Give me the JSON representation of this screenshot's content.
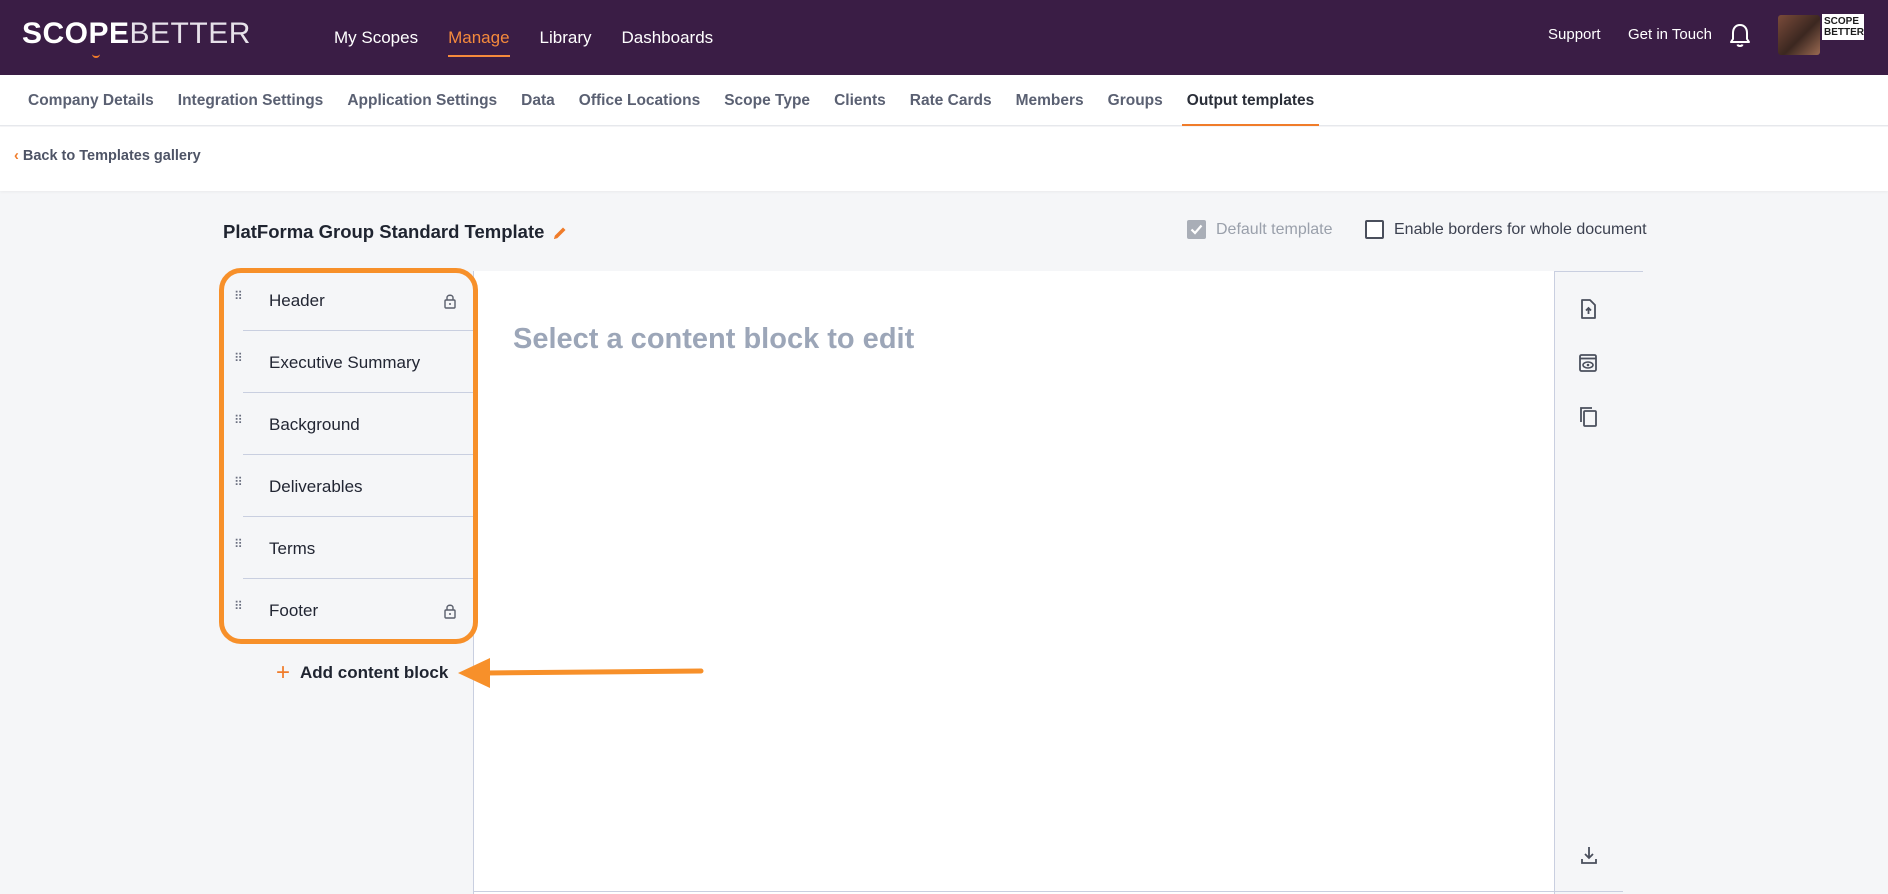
{
  "brand": {
    "logo_part1": "SCOPE",
    "logo_part2": "BETTER",
    "mini_logo_line1": "SCOPE",
    "mini_logo_line2": "BETTER"
  },
  "top_nav": {
    "items": [
      "My Scopes",
      "Manage",
      "Library",
      "Dashboards"
    ],
    "active": "Manage"
  },
  "top_right": {
    "support": "Support",
    "get_in_touch": "Get in Touch"
  },
  "sub_nav": {
    "items": [
      "Company Details",
      "Integration Settings",
      "Application Settings",
      "Data",
      "Office Locations",
      "Scope Type",
      "Clients",
      "Rate Cards",
      "Members",
      "Groups",
      "Output templates"
    ],
    "active": "Output templates"
  },
  "back_link": "Back to Templates gallery",
  "template": {
    "title": "PlatForma Group Standard Template",
    "default_template_label": "Default template",
    "default_template_checked": true,
    "borders_label": "Enable borders for whole document",
    "borders_checked": false
  },
  "blocks": [
    {
      "label": "Header",
      "locked": true
    },
    {
      "label": "Executive Summary",
      "locked": false
    },
    {
      "label": "Background",
      "locked": false
    },
    {
      "label": "Deliverables",
      "locked": false
    },
    {
      "label": "Terms",
      "locked": false
    },
    {
      "label": "Footer",
      "locked": true
    }
  ],
  "add_block_label": "Add content block",
  "editor_placeholder": "Select a content block to edit",
  "colors": {
    "accent": "#f07c2a",
    "header_bg": "#3a1d45",
    "highlight": "#f7902a"
  },
  "icons": [
    "bell-icon",
    "pencil-icon",
    "drag-handle-icon",
    "lock-icon",
    "upload-file-icon",
    "preview-icon",
    "copy-icon",
    "download-icon",
    "plus-icon",
    "arrow-annotation"
  ]
}
